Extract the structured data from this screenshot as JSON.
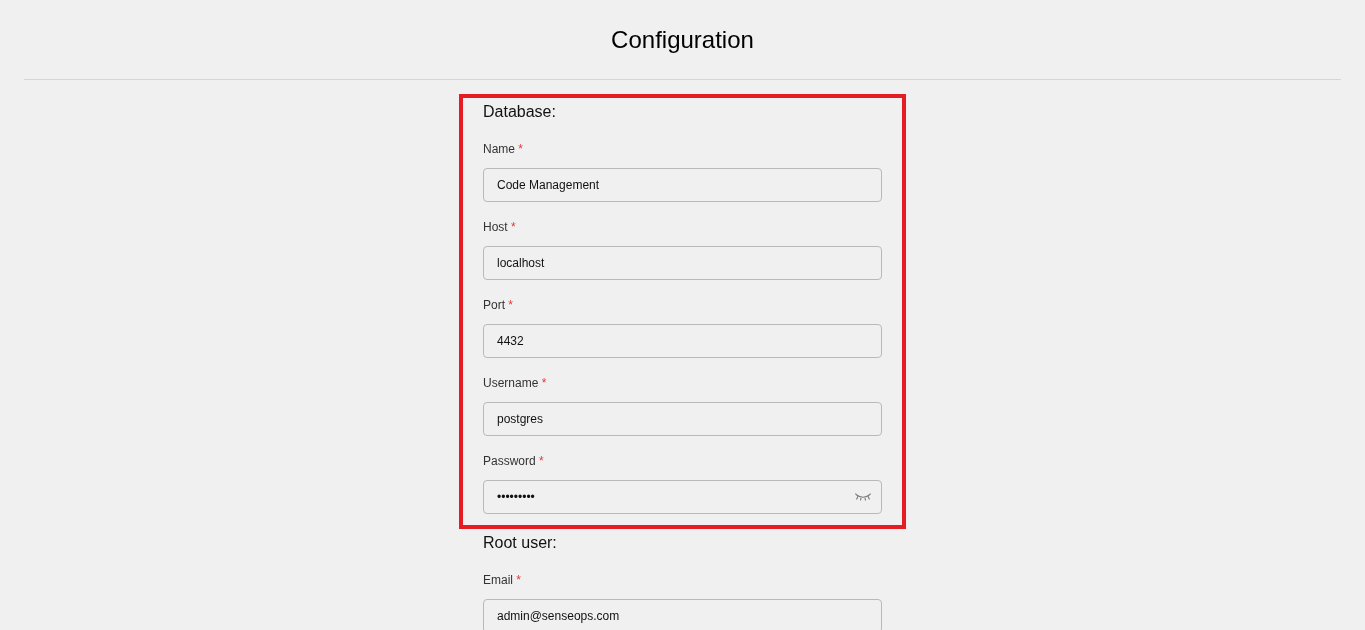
{
  "page": {
    "title": "Configuration"
  },
  "sections": [
    {
      "heading": "Database:",
      "highlighted": true,
      "fields": [
        {
          "label": "Name",
          "required_mark": "*",
          "kind": "text",
          "value": "Code Management"
        },
        {
          "label": "Host",
          "required_mark": "*",
          "kind": "text",
          "value": "localhost"
        },
        {
          "label": "Port",
          "required_mark": "*",
          "kind": "text",
          "value": "4432"
        },
        {
          "label": "Username",
          "required_mark": "*",
          "kind": "text",
          "value": "postgres"
        },
        {
          "label": "Password",
          "required_mark": "*",
          "kind": "password",
          "value": "•••••••••"
        }
      ]
    },
    {
      "heading": "Root user:",
      "highlighted": false,
      "fields": [
        {
          "label": "Email",
          "required_mark": "*",
          "kind": "text",
          "value": "admin@senseops.com"
        }
      ]
    }
  ]
}
